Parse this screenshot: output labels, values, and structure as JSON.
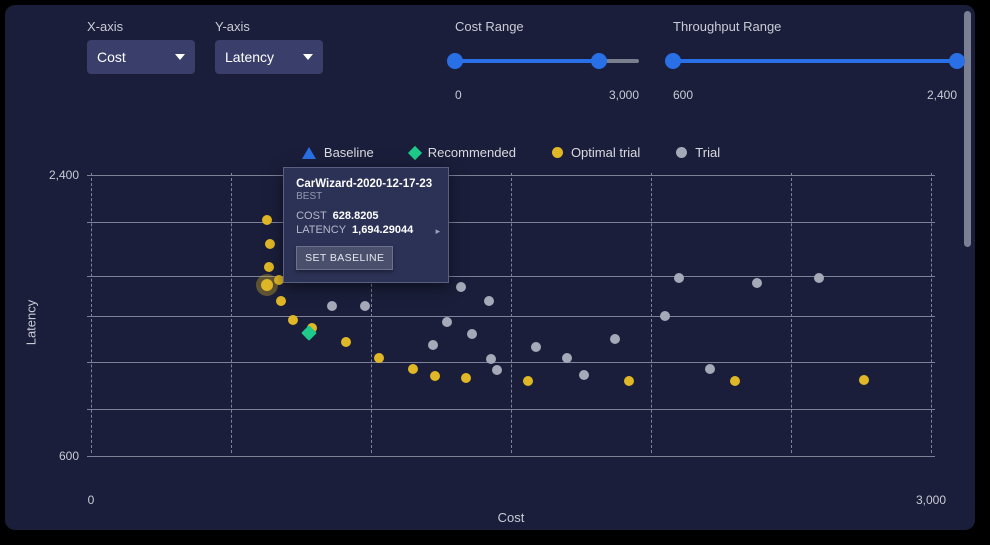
{
  "controls": {
    "xaxis": {
      "label": "X-axis",
      "value": "Cost"
    },
    "yaxis": {
      "label": "Y-axis",
      "value": "Latency"
    },
    "cost_range": {
      "label": "Cost Range",
      "min": "0",
      "max": "3,000",
      "fill_pct": 78
    },
    "throughput_range": {
      "label": "Throughput Range",
      "min": "600",
      "max": "2,400",
      "fill_pct": 100
    }
  },
  "legend": {
    "baseline": "Baseline",
    "recommended": "Recommended",
    "optimal": "Optimal trial",
    "trial": "Trial"
  },
  "axes": {
    "xlabel": "Cost",
    "ylabel": "Latency",
    "xticks": [
      "0",
      "3,000"
    ],
    "yticks": [
      "2,400",
      "600"
    ]
  },
  "tooltip": {
    "title": "CarWizard-2020-12-17-23",
    "subtitle": "BEST",
    "cost_label": "COST",
    "cost_value": "628.8205",
    "latency_label": "LATENCY",
    "latency_value": "1,694.29044",
    "button": "SET BASELINE"
  },
  "chart_data": {
    "type": "scatter",
    "title": "",
    "xlabel": "Cost",
    "ylabel": "Latency",
    "xlim": [
      0,
      3000
    ],
    "ylim": [
      600,
      2400
    ],
    "series": [
      {
        "name": "Trial",
        "points": [
          {
            "x": 820,
            "y": 1750
          },
          {
            "x": 870,
            "y": 1750
          },
          {
            "x": 960,
            "y": 1750
          },
          {
            "x": 860,
            "y": 1560
          },
          {
            "x": 980,
            "y": 1560
          },
          {
            "x": 1320,
            "y": 1680
          },
          {
            "x": 1420,
            "y": 1590
          },
          {
            "x": 1270,
            "y": 1460
          },
          {
            "x": 1220,
            "y": 1310
          },
          {
            "x": 1360,
            "y": 1380
          },
          {
            "x": 1430,
            "y": 1220
          },
          {
            "x": 1450,
            "y": 1150
          },
          {
            "x": 1590,
            "y": 1300
          },
          {
            "x": 1700,
            "y": 1230
          },
          {
            "x": 1760,
            "y": 1120
          },
          {
            "x": 1870,
            "y": 1350
          },
          {
            "x": 2050,
            "y": 1500
          },
          {
            "x": 2100,
            "y": 1740
          },
          {
            "x": 2210,
            "y": 1160
          },
          {
            "x": 2380,
            "y": 1710
          },
          {
            "x": 2600,
            "y": 1740
          }
        ]
      },
      {
        "name": "Optimal trial",
        "points": [
          {
            "x": 630,
            "y": 2110
          },
          {
            "x": 640,
            "y": 1960
          },
          {
            "x": 635,
            "y": 1810
          },
          {
            "x": 670,
            "y": 1730
          },
          {
            "x": 680,
            "y": 1590
          },
          {
            "x": 720,
            "y": 1470
          },
          {
            "x": 790,
            "y": 1420
          },
          {
            "x": 910,
            "y": 1330
          },
          {
            "x": 1030,
            "y": 1230
          },
          {
            "x": 1150,
            "y": 1160
          },
          {
            "x": 1230,
            "y": 1110
          },
          {
            "x": 1340,
            "y": 1100
          },
          {
            "x": 1560,
            "y": 1080
          },
          {
            "x": 1920,
            "y": 1080
          },
          {
            "x": 2300,
            "y": 1080
          },
          {
            "x": 2760,
            "y": 1090
          }
        ]
      },
      {
        "name": "Recommended",
        "points": [
          {
            "x": 780,
            "y": 1390
          }
        ]
      },
      {
        "name": "Baseline",
        "points": [
          {
            "x": 1220,
            "y": 1770
          }
        ]
      },
      {
        "name": "Selected",
        "points": [
          {
            "x": 629,
            "y": 1694
          }
        ]
      }
    ]
  }
}
